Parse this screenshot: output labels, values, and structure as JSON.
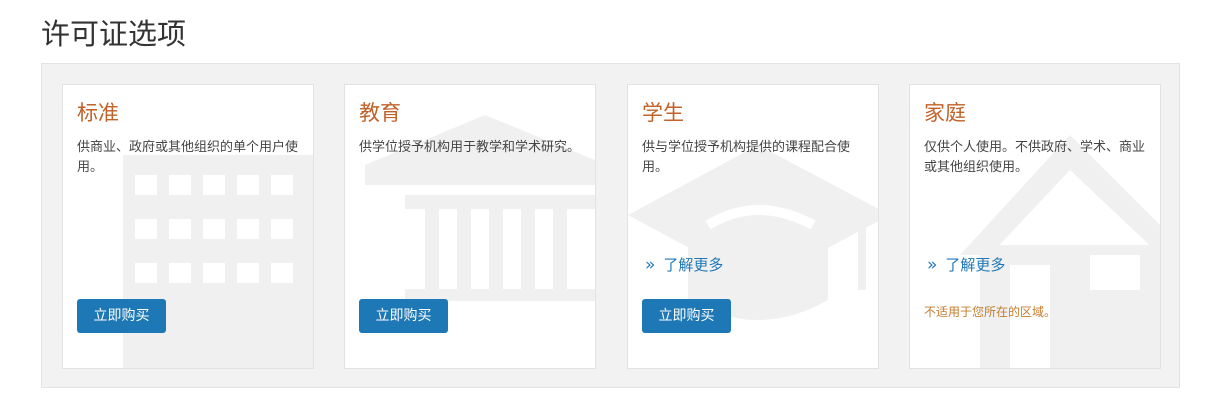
{
  "page": {
    "title": "许可证选项"
  },
  "cards": [
    {
      "title": "标准",
      "description": "供商业、政府或其他组织的单个用户使用。",
      "buy_label": "立即购买",
      "background_icon": "office-building-icon"
    },
    {
      "title": "教育",
      "description": "供学位授予机构用于教学和学术研究。",
      "buy_label": "立即购买",
      "background_icon": "institution-columns-icon"
    },
    {
      "title": "学生",
      "description": "供与学位授予机构提供的课程配合使用。",
      "learn_more_chevron": "»",
      "learn_more_label": "了解更多",
      "buy_label": "立即购买",
      "background_icon": "graduation-cap-icon"
    },
    {
      "title": "家庭",
      "description": "仅供个人使用。不供政府、学术、商业或其他组织使用。",
      "learn_more_chevron": "»",
      "learn_more_label": "了解更多",
      "notice": "不适用于您所在的区域。",
      "background_icon": "house-icon"
    }
  ],
  "colors": {
    "card_title": "#c0622a",
    "button_bg": "#1e78b6",
    "link": "#1f78b8",
    "notice": "#c47c2c",
    "panel_bg": "#f2f2f2",
    "watermark": "#f0f0f0"
  }
}
